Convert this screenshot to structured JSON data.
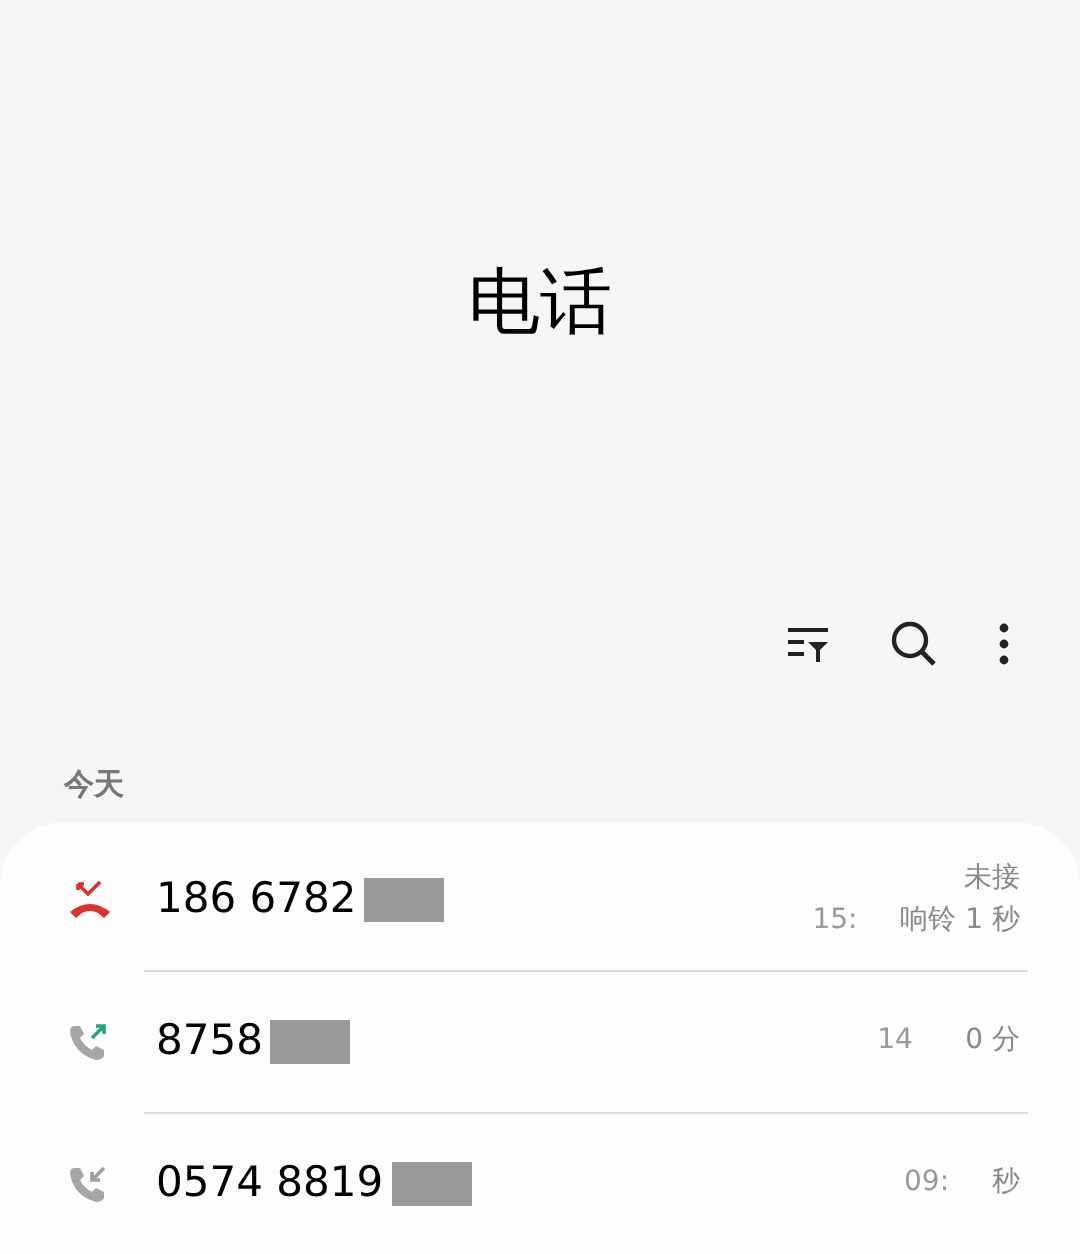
{
  "title": "电话",
  "section": "今天",
  "calls": [
    {
      "kind": "missed",
      "number": "186 6782",
      "time": "15:",
      "status": "未接",
      "detail": "响铃 1 秒"
    },
    {
      "kind": "outgoing",
      "number": "8758",
      "time": "14",
      "detail": "0 分"
    },
    {
      "kind": "incoming",
      "number": "0574 8819",
      "time": "09:",
      "detail": "秒"
    }
  ]
}
